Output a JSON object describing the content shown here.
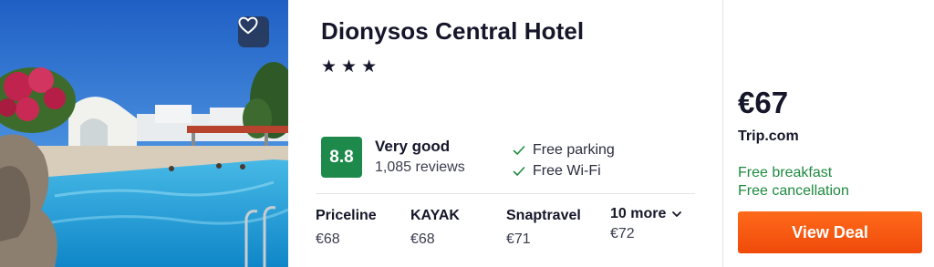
{
  "hotel": {
    "name": "Dionysos Central Hotel",
    "stars": [
      "★",
      "★",
      "★"
    ]
  },
  "photo": {
    "favorite_icon": "heart-outline-icon"
  },
  "rating": {
    "score": "8.8",
    "label": "Very good",
    "reviews": "1,085 reviews",
    "badge_color": "#1d8a4b"
  },
  "amenities": [
    {
      "icon": "check-icon",
      "label": "Free parking"
    },
    {
      "icon": "check-icon",
      "label": "Free Wi-Fi"
    }
  ],
  "providers": [
    {
      "name": "Priceline",
      "price": "€68"
    },
    {
      "name": "KAYAK",
      "price": "€68"
    },
    {
      "name": "Snaptravel",
      "price": "€71"
    },
    {
      "name": "10 more",
      "price": "€72",
      "icon": "chevron-down-icon"
    }
  ],
  "deal": {
    "price": "€67",
    "source": "Trip.com",
    "perks": [
      "Free breakfast",
      "Free cancellation"
    ],
    "perk_color": "#1d8a3f",
    "button_label": "View Deal",
    "button_color": "#f55a10"
  }
}
